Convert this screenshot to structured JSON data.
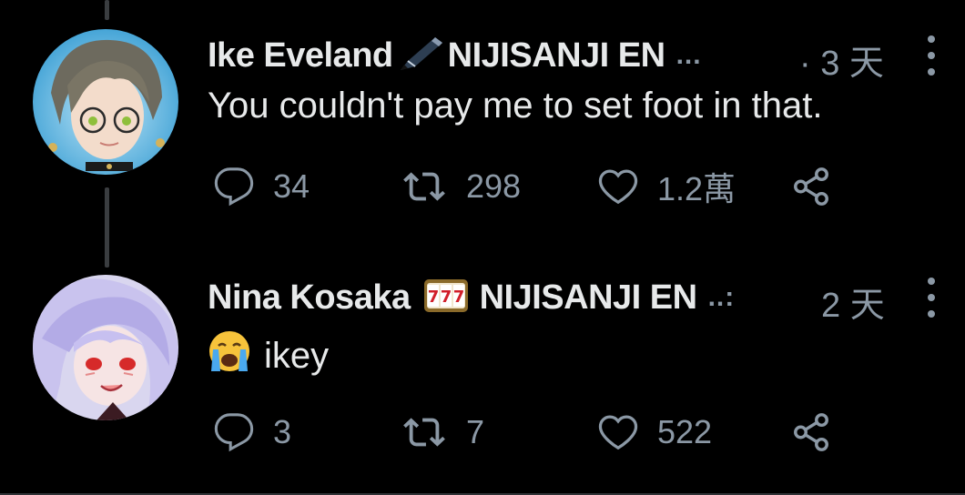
{
  "tweets": [
    {
      "name": "Ike Eveland",
      "org": "NIJISANJI EN",
      "name_icon": "pen-icon",
      "ellipsis": "...",
      "time": "· 3 天",
      "text": "You couldn't pay me to set foot in that.",
      "replies": "34",
      "retweets": "298",
      "likes": "1.2萬"
    },
    {
      "name": "Nina Kosaka",
      "org": "NIJISANJI EN",
      "name_icon": "slot-machine-icon",
      "ellipsis": "..:",
      "time": "2 天",
      "text_emoji": "crying-face-icon",
      "text": "ikey",
      "replies": "3",
      "retweets": "7",
      "likes": "522"
    }
  ],
  "colors": {
    "background": "#000000",
    "text": "#e7e9ea",
    "muted": "#8b98a5",
    "thread_line": "#3a3d40"
  }
}
